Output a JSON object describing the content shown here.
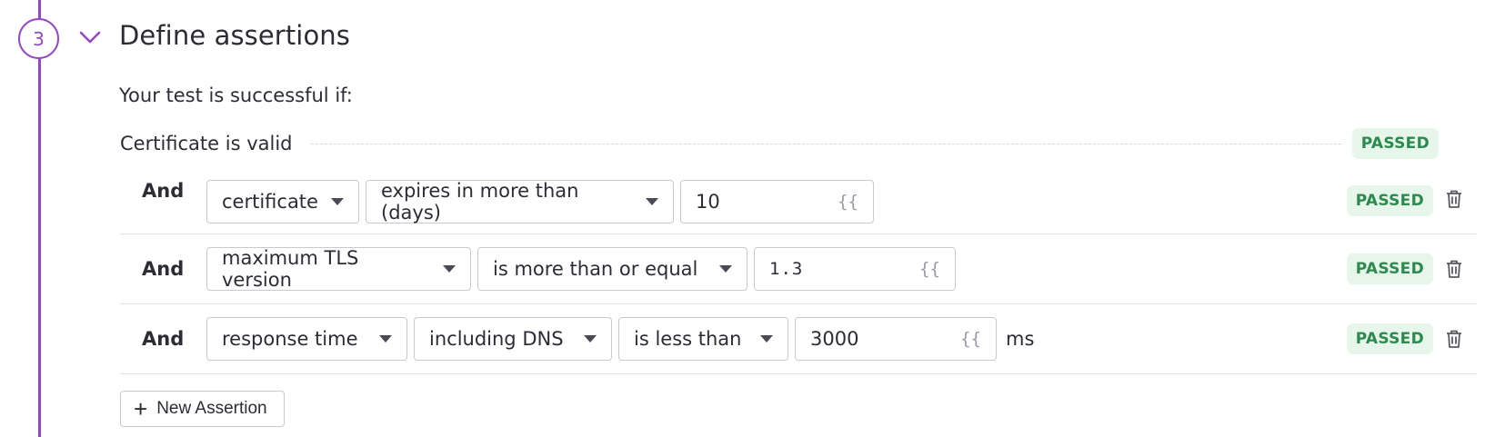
{
  "step": {
    "number": "3",
    "title": "Define assertions"
  },
  "intro": "Your test is successful if:",
  "certificate": {
    "label": "Certificate is valid",
    "status": "PASSED"
  },
  "assertions": [
    {
      "conjunction": "And",
      "field": "certificate",
      "operator": "expires in more than (days)",
      "value": "10",
      "value_style": "text",
      "template": "{{",
      "suffix": "",
      "status": "PASSED"
    },
    {
      "conjunction": "And",
      "field": "maximum TLS version",
      "operator": "is more than or equal",
      "value": "1.3",
      "value_style": "mono",
      "template": "{{",
      "suffix": "",
      "status": "PASSED"
    },
    {
      "conjunction": "And",
      "field": "response time",
      "subfield": "including DNS",
      "operator": "is less than",
      "value": "3000",
      "value_style": "text",
      "template": "{{",
      "suffix": "ms",
      "status": "PASSED"
    }
  ],
  "new_assertion_label": "New Assertion",
  "colors": {
    "accent": "#9549c1",
    "passed_bg": "#e6f6ea",
    "passed_text": "#2d8a4e",
    "border": "#c9c9d1"
  },
  "icons": {
    "chevron": "chevron-down-icon",
    "trash": "trash-icon",
    "plus": "plus-icon"
  }
}
